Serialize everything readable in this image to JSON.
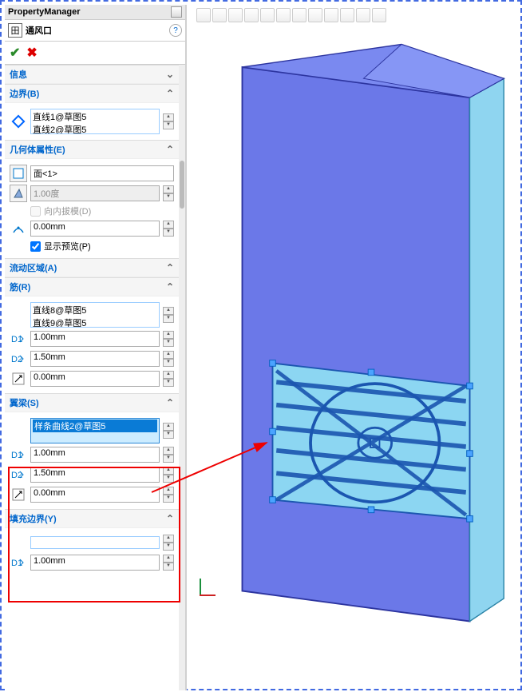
{
  "header": {
    "title": "PropertyManager"
  },
  "feature": {
    "title": "通风口"
  },
  "sections": {
    "info": "信息",
    "boundary": {
      "label": "边界(B)",
      "items": [
        "直线1@草图5",
        "直线2@草图5"
      ]
    },
    "geom": {
      "label": "几何体属性(E)",
      "face": "面<1>",
      "draft": "1.00度",
      "draft_inward": "向内拔模(D)",
      "offset": "0.00mm",
      "preview": "显示预览(P)"
    },
    "flow": {
      "label": "流动区域(A)"
    },
    "ribs": {
      "label": "筋(R)",
      "items": [
        "直线8@草图5",
        "直线9@草图5"
      ],
      "d1": "1.00mm",
      "d2": "1.50mm",
      "d3": "0.00mm"
    },
    "spars": {
      "label": "翼梁(S)",
      "items": [
        "样条曲线2@草图5"
      ],
      "d1": "1.00mm",
      "d2": "1.50mm",
      "d3": "0.00mm"
    },
    "fill": {
      "label": "填充边界(Y)",
      "d1": "1.00mm"
    }
  }
}
